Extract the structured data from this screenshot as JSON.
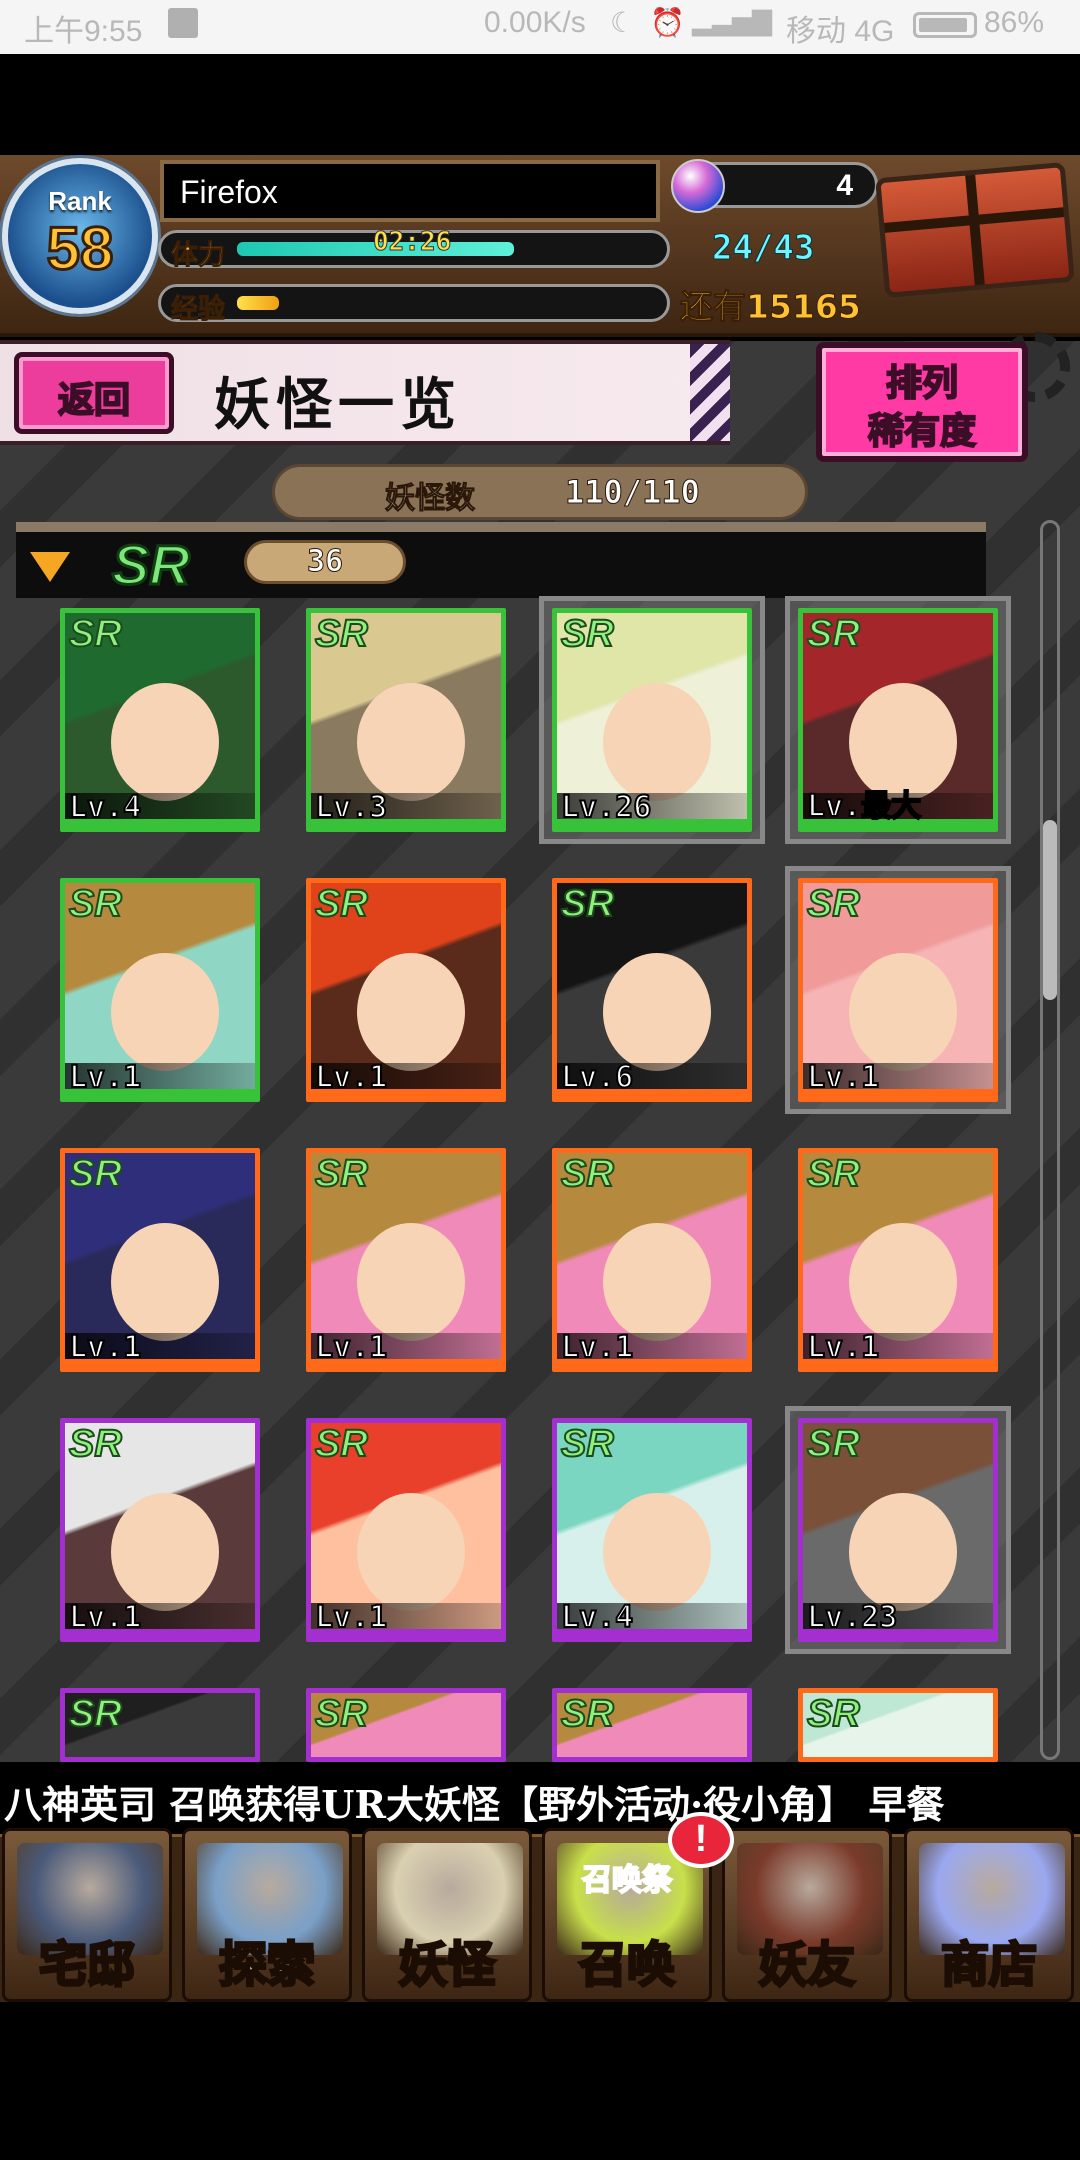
{
  "status_bar": {
    "time": "上午9:55",
    "net_speed": "0.00K/s",
    "carrier": "移动 4G",
    "battery": "86%"
  },
  "header": {
    "rank_label": "Rank",
    "rank_value": "58",
    "player_name": "Firefox",
    "stamina_label": "体力",
    "stamina_timer": "02:26",
    "stamina_fill_fraction": 0.66,
    "exp_label": "经验",
    "exp_fill_fraction": 0.1,
    "gem_count": "4",
    "capacity": "24/43",
    "exp_remaining": "还有15165"
  },
  "page": {
    "back_label": "返回",
    "title": "妖怪一览",
    "sort_label_1": "排列",
    "sort_label_2": "稀有度",
    "monster_count_label": "妖怪数",
    "monster_count_value": "110/110"
  },
  "rarity_group": {
    "rarity": "SR",
    "count": "36"
  },
  "cards": [
    {
      "level": "Lv.4",
      "rarity": "SR",
      "frame": "#38c23a",
      "bg": "#2c5a2c",
      "hair": "#1f6a2e",
      "selected": false
    },
    {
      "level": "Lv.3",
      "rarity": "SR",
      "frame": "#38c23a",
      "bg": "#8a7a60",
      "hair": "#d9c890",
      "selected": false
    },
    {
      "level": "Lv.26",
      "rarity": "SR",
      "frame": "#38c23a",
      "bg": "#eef0d8",
      "hair": "#dfe6a8",
      "selected": true
    },
    {
      "level": "Lv.最大",
      "rarity": "SR",
      "frame": "#38c23a",
      "bg": "#5a2a2a",
      "hair": "#a3262a",
      "selected": true
    },
    {
      "level": "Lv.1",
      "rarity": "SR",
      "frame": "#38c23a",
      "bg": "#8fd6c4",
      "hair": "#b68a3e",
      "selected": false
    },
    {
      "level": "Lv.1",
      "rarity": "SR",
      "frame": "#ff6a1a",
      "bg": "#5a2a1a",
      "hair": "#e0421a",
      "selected": false
    },
    {
      "level": "Lv.6",
      "rarity": "SR",
      "frame": "#ff6a1a",
      "bg": "#3a3a3a",
      "hair": "#141414",
      "selected": false
    },
    {
      "level": "Lv.1",
      "rarity": "SR",
      "frame": "#ff6a1a",
      "bg": "#f6b4b4",
      "hair": "#f09a9a",
      "selected": true
    },
    {
      "level": "Lv.1",
      "rarity": "SR",
      "frame": "#ff6a1a",
      "bg": "#2a2a5a",
      "hair": "#2e2e7a",
      "selected": false
    },
    {
      "level": "Lv.1",
      "rarity": "SR",
      "frame": "#ff6a1a",
      "bg": "#f08ab8",
      "hair": "#b68a3e",
      "selected": false
    },
    {
      "level": "Lv.1",
      "rarity": "SR",
      "frame": "#ff6a1a",
      "bg": "#f08ab8",
      "hair": "#b68a3e",
      "selected": false
    },
    {
      "level": "Lv.1",
      "rarity": "SR",
      "frame": "#ff6a1a",
      "bg": "#f08ab8",
      "hair": "#b68a3e",
      "selected": false
    },
    {
      "level": "Lv.1",
      "rarity": "SR",
      "frame": "#a42fd0",
      "bg": "#5a3a3a",
      "hair": "#e6e6e6",
      "selected": false
    },
    {
      "level": "Lv.1",
      "rarity": "SR",
      "frame": "#a42fd0",
      "bg": "#ffc0a0",
      "hair": "#e8402a",
      "selected": false
    },
    {
      "level": "Lv.4",
      "rarity": "SR",
      "frame": "#a42fd0",
      "bg": "#d8f0ec",
      "hair": "#7ad6c0",
      "selected": false
    },
    {
      "level": "Lv.23",
      "rarity": "SR",
      "frame": "#a42fd0",
      "bg": "#6a6a6a",
      "hair": "#7a5038",
      "selected": true
    },
    {
      "level": "",
      "rarity": "SR",
      "frame": "#a42fd0",
      "bg": "#3a3a3a",
      "hair": "#1f1f1f",
      "selected": false
    },
    {
      "level": "",
      "rarity": "SR",
      "frame": "#a42fd0",
      "bg": "#f08ab8",
      "hair": "#b68a3e",
      "selected": false
    },
    {
      "level": "",
      "rarity": "SR",
      "frame": "#a42fd0",
      "bg": "#f08ab8",
      "hair": "#b68a3e",
      "selected": false
    },
    {
      "level": "",
      "rarity": "SR",
      "frame": "#ff6a1a",
      "bg": "#e6f4ea",
      "hair": "#bfe8d4",
      "selected": false
    }
  ],
  "ticker_text": "八神英司 召唤获得UR大妖怪【野外活动·役小角】   早餐",
  "nav": [
    {
      "label": "宅邸",
      "icon": "mansion-icon",
      "color": "#4a5a7a"
    },
    {
      "label": "探索",
      "icon": "magnifier-icon",
      "color": "#7aa0c8"
    },
    {
      "label": "妖怪",
      "icon": "scroll-icon",
      "color": "#d9d0b0"
    },
    {
      "label": "召唤",
      "sub": "召唤祭",
      "icon": "summon-star-icon",
      "color": "#c8e04a"
    },
    {
      "label": "妖友",
      "icon": "friend-girl-icon",
      "color": "#7a3a2a"
    },
    {
      "label": "商店",
      "icon": "crystal-orb-icon",
      "color": "#9aa8f0"
    }
  ],
  "summon_badge": "!"
}
